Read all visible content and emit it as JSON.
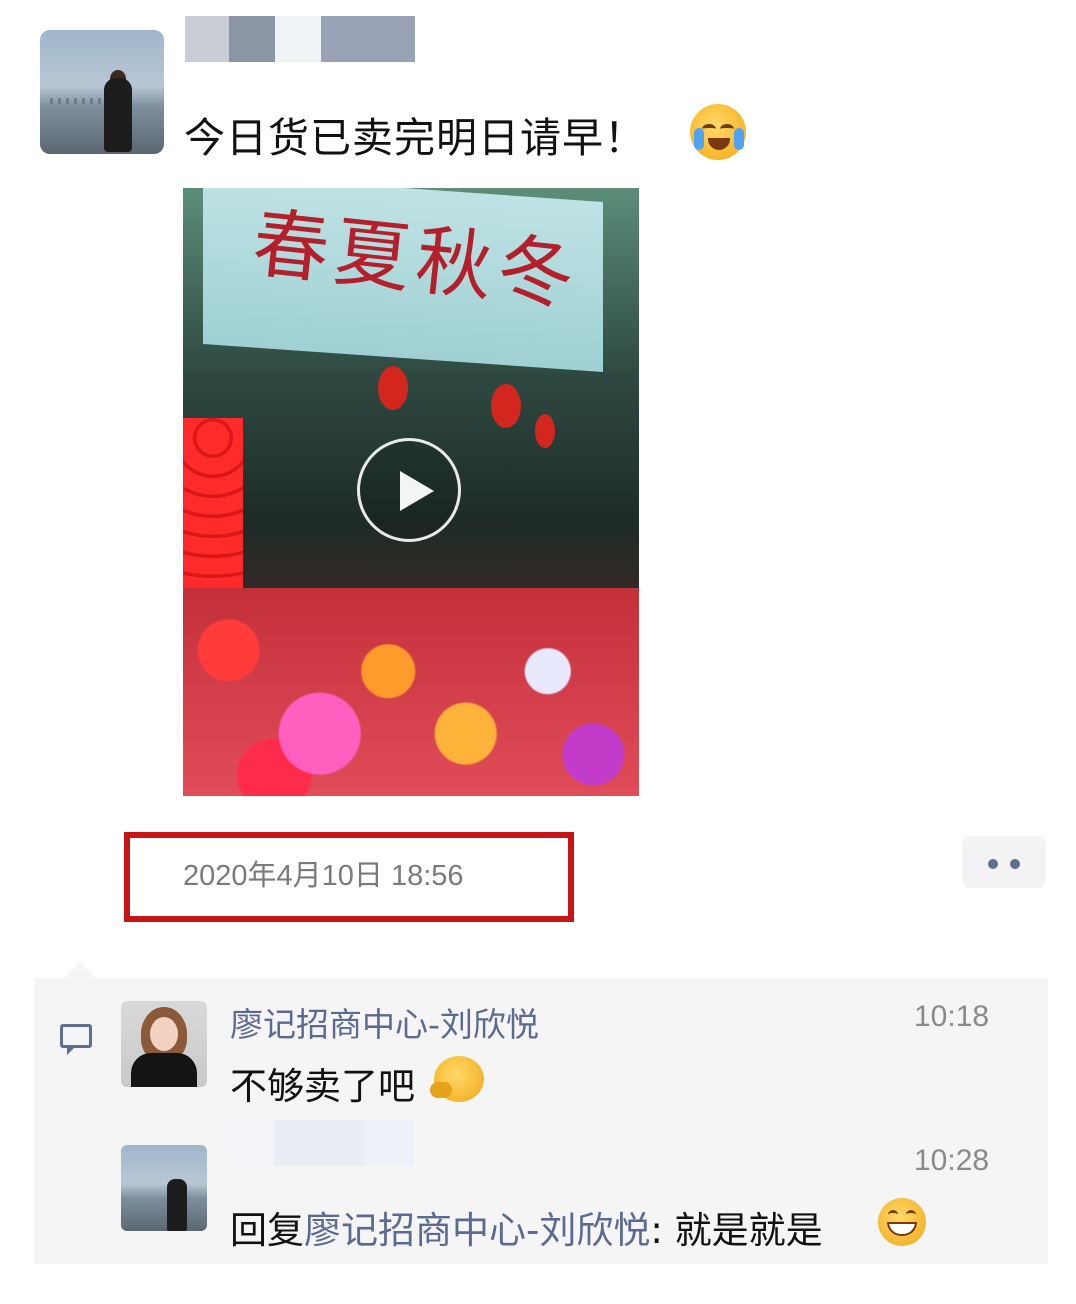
{
  "post": {
    "text": "今日货已卖完明日请早！",
    "emoji": "laugh-cry-emoji",
    "video": {
      "sign_text": "春夏秋冬",
      "play_icon": "play-icon"
    },
    "timestamp": "2020年4月10日 18:56",
    "more_icon": "more-dots-icon",
    "highlight_color": "#c81414"
  },
  "comments": [
    {
      "name": "廖记招商中心-刘欣悦",
      "time": "10:18",
      "text": "不够卖了吧",
      "emoji": "thinking-emoji"
    },
    {
      "time": "10:28",
      "reply_prefix": "回复",
      "reply_to": "廖记招商中心-刘欣悦",
      "reply_sep": ": ",
      "text": "就是就是",
      "emoji": "grin-emoji"
    }
  ],
  "colors": {
    "name_link": "#5b6a92",
    "timestamp": "#7a7a7a",
    "comment_bg": "#f5f5f5"
  }
}
